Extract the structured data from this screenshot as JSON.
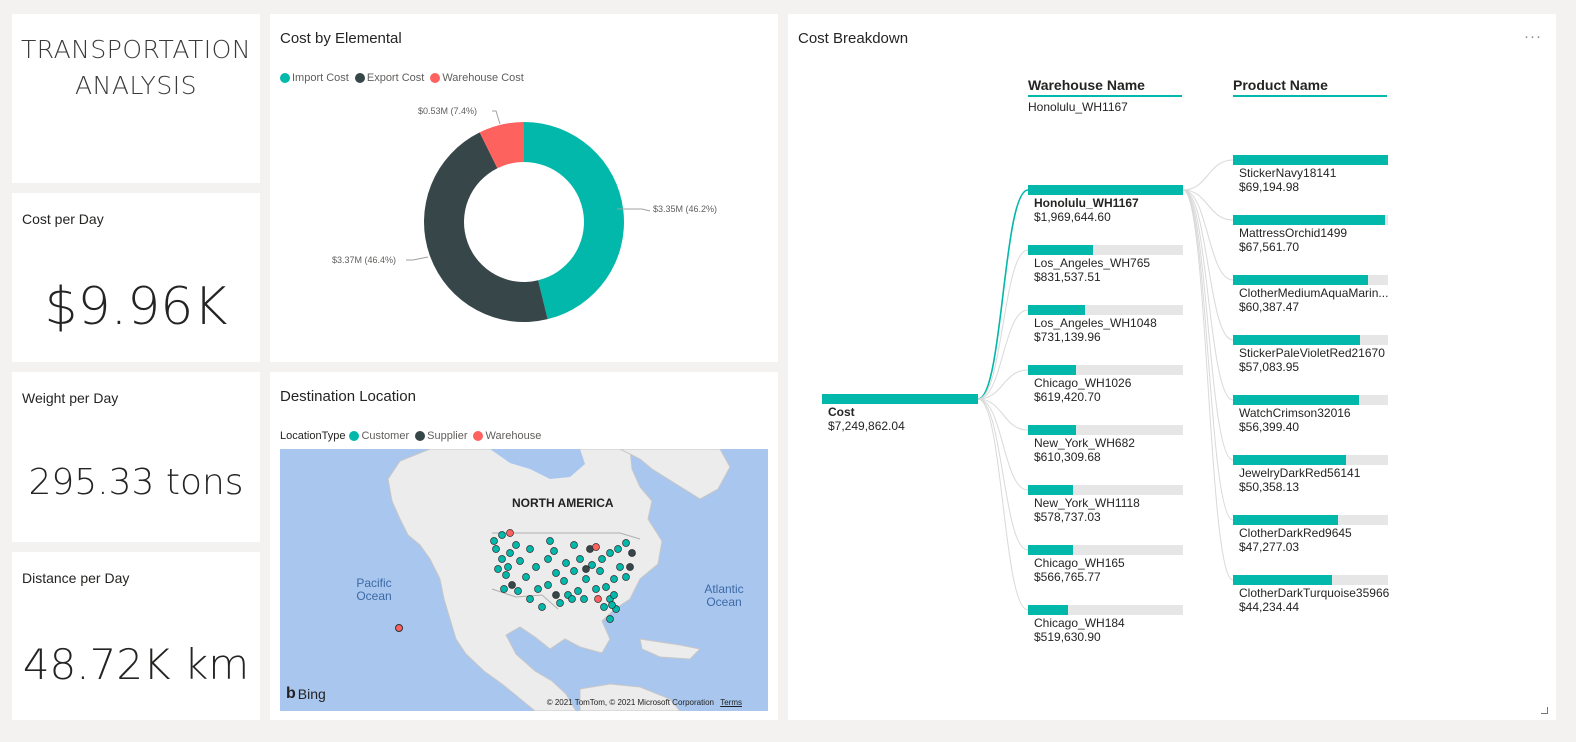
{
  "title_card": {
    "line1": "TRANSPORTATION",
    "line2": "ANALYSIS"
  },
  "kpis": {
    "cost": {
      "label": "Cost per Day",
      "value": "$9.96K"
    },
    "weight": {
      "label": "Weight per Day",
      "value": "295.33 tons"
    },
    "distance": {
      "label": "Distance per Day",
      "value": "48.72K km"
    }
  },
  "donut": {
    "title": "Cost by Elemental",
    "legend": [
      {
        "name": "Import Cost",
        "color": "#01b8aa"
      },
      {
        "name": "Export Cost",
        "color": "#374649"
      },
      {
        "name": "Warehouse Cost",
        "color": "#fd625e"
      }
    ],
    "labels": {
      "import": "$3.35M (46.2%)",
      "export": "$3.37M (46.4%)",
      "warehouse": "$0.53M (7.4%)"
    }
  },
  "chart_data": {
    "type": "pie",
    "title": "Cost by Elemental",
    "donut": true,
    "categories": [
      "Import Cost",
      "Export Cost",
      "Warehouse Cost"
    ],
    "values": [
      3.35,
      3.37,
      0.53
    ],
    "percentages": [
      46.2,
      46.4,
      7.4
    ],
    "unit": "$M",
    "colors": [
      "#01b8aa",
      "#374649",
      "#fd625e"
    ],
    "legend": "top-left"
  },
  "map": {
    "title": "Destination Location",
    "legend_title": "LocationType",
    "legend": [
      {
        "name": "Customer",
        "color": "#01b8aa"
      },
      {
        "name": "Supplier",
        "color": "#374649"
      },
      {
        "name": "Warehouse",
        "color": "#fd625e"
      }
    ],
    "label_na": "NORTH AMERICA",
    "label_pacific": "Pacific Ocean",
    "label_atlantic": "Atlantic Ocean",
    "bing": "Bing",
    "copyright": "© 2021 TomTom, © 2021 Microsoft Corporation",
    "terms": "Terms"
  },
  "tree": {
    "title": "Cost Breakdown",
    "more": "···",
    "col1_head": "Warehouse Name",
    "col1_selected": "Honolulu_WH1167",
    "col2_head": "Product Name",
    "root": {
      "name": "Cost",
      "value": "$7,249,862.04",
      "fill": 1.0
    },
    "warehouses": [
      {
        "name": "Honolulu_WH1167",
        "value": "$1,969,644.60",
        "fill": 1.0,
        "selected": true
      },
      {
        "name": "Los_Angeles_WH765",
        "value": "$831,537.51",
        "fill": 0.42
      },
      {
        "name": "Los_Angeles_WH1048",
        "value": "$731,139.96",
        "fill": 0.37
      },
      {
        "name": "Chicago_WH1026",
        "value": "$619,420.70",
        "fill": 0.31
      },
      {
        "name": "New_York_WH682",
        "value": "$610,309.68",
        "fill": 0.31
      },
      {
        "name": "New_York_WH1118",
        "value": "$578,737.03",
        "fill": 0.29
      },
      {
        "name": "Chicago_WH165",
        "value": "$566,765.77",
        "fill": 0.29
      },
      {
        "name": "Chicago_WH184",
        "value": "$519,630.90",
        "fill": 0.26
      }
    ],
    "products": [
      {
        "name": "StickerNavy18141",
        "value": "$69,194.98",
        "fill": 1.0
      },
      {
        "name": "MattressOrchid1499",
        "value": "$67,561.70",
        "fill": 0.98
      },
      {
        "name": "ClotherMediumAquaMarin...",
        "value": "$60,387.47",
        "fill": 0.87
      },
      {
        "name": "StickerPaleVioletRed21670",
        "value": "$57,083.95",
        "fill": 0.82
      },
      {
        "name": "WatchCrimson32016",
        "value": "$56,399.40",
        "fill": 0.81
      },
      {
        "name": "JewelryDarkRed56141",
        "value": "$50,358.13",
        "fill": 0.73
      },
      {
        "name": "ClotherDarkRed9645",
        "value": "$47,277.03",
        "fill": 0.68
      },
      {
        "name": "ClotherDarkTurquoise35966",
        "value": "$44,234.44",
        "fill": 0.64
      }
    ]
  }
}
